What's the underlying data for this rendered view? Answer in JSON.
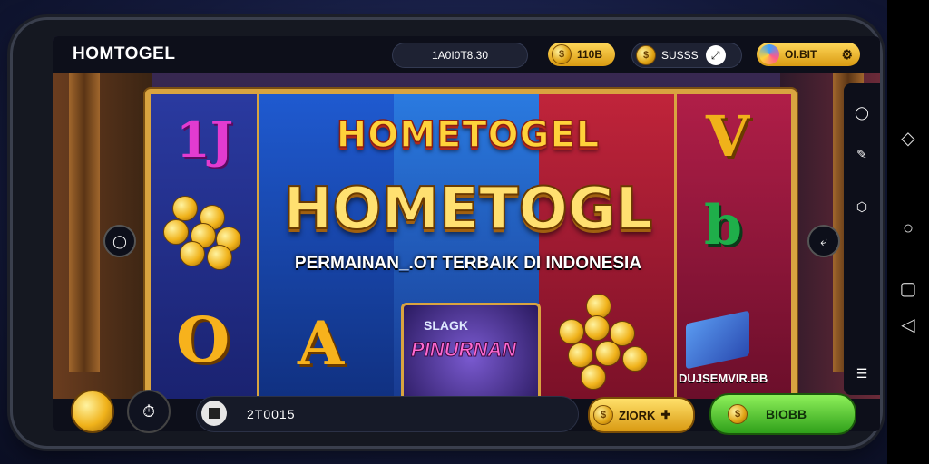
{
  "app": {
    "brand": "HOMTOGEL"
  },
  "topbar": {
    "center_value": "1A0I0T8.30",
    "coin_pill": "110B",
    "gem_pill": "SUSSS",
    "profile_pill": "OI.BIT"
  },
  "banner": {
    "title_small": "HOMETOGEL",
    "title_big": "HOMETOGL",
    "subtitle": "PERMAINAN_.OT TERBAIK DI INDONESIA"
  },
  "reels": {
    "sym_1j": "1J",
    "sym_v": "V",
    "sym_o": "O",
    "sym_a": "A",
    "bonus_top": "SLAGK",
    "bonus_main": "PINURNAN",
    "gift_label": "DUJSEMVIR.BB"
  },
  "bottombar": {
    "bet_value": "2T0015",
    "gold_button": "ZIORK",
    "green_button": "BIOBB"
  },
  "icons": {
    "coin": "coin-icon",
    "gem": "gem-icon",
    "avatar": "avatar-icon",
    "stop": "stop-icon",
    "back": "back-icon",
    "home": "home-icon",
    "recent": "recent-icon"
  },
  "colors": {
    "accent_gold": "#d9a440",
    "button_green": "#2fa01a",
    "topbar_bg": "#0d0f1a"
  }
}
